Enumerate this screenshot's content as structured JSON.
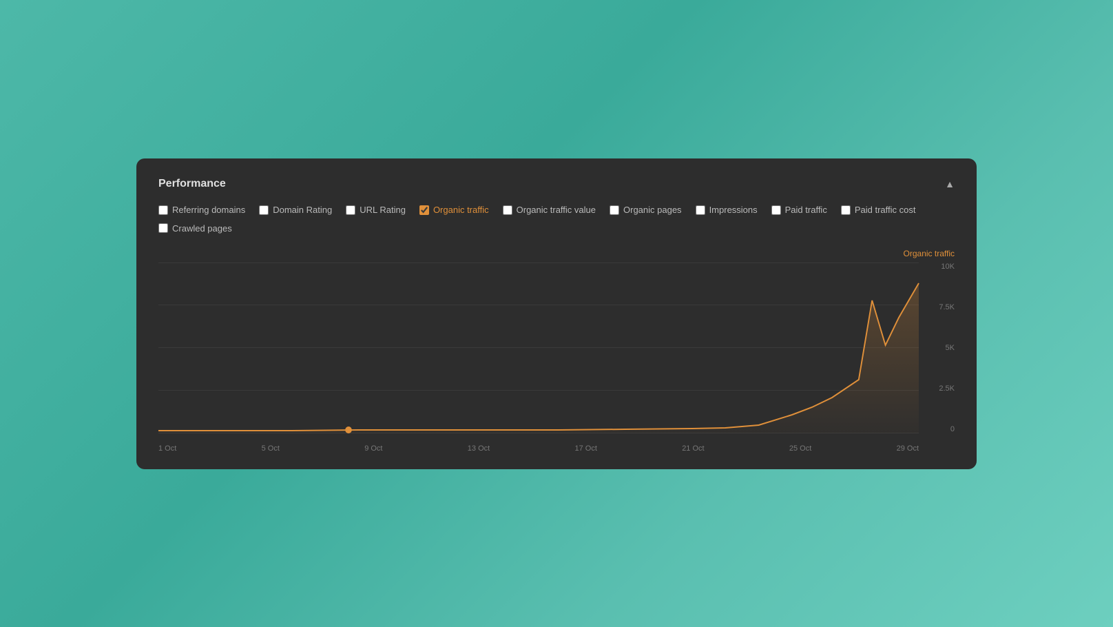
{
  "card": {
    "title": "Performance",
    "collapse_label": "▲"
  },
  "filters": [
    {
      "id": "referring-domains",
      "label": "Referring domains",
      "checked": false
    },
    {
      "id": "domain-rating",
      "label": "Domain Rating",
      "checked": false
    },
    {
      "id": "url-rating",
      "label": "URL Rating",
      "checked": false
    },
    {
      "id": "organic-traffic",
      "label": "Organic traffic",
      "checked": true
    },
    {
      "id": "organic-traffic-value",
      "label": "Organic traffic value",
      "checked": false
    },
    {
      "id": "organic-pages",
      "label": "Organic pages",
      "checked": false
    },
    {
      "id": "impressions",
      "label": "Impressions",
      "checked": false
    },
    {
      "id": "paid-traffic",
      "label": "Paid traffic",
      "checked": false
    },
    {
      "id": "paid-traffic-cost",
      "label": "Paid traffic cost",
      "checked": false
    },
    {
      "id": "crawled-pages",
      "label": "Crawled pages",
      "checked": false
    }
  ],
  "chart": {
    "legend": "Organic traffic",
    "y_labels": [
      "10K",
      "7.5K",
      "5K",
      "2.5K",
      "0"
    ],
    "x_labels": [
      "1 Oct",
      "5 Oct",
      "9 Oct",
      "13 Oct",
      "17 Oct",
      "21 Oct",
      "25 Oct",
      "29 Oct"
    ],
    "accent_color": "#e0903a"
  }
}
